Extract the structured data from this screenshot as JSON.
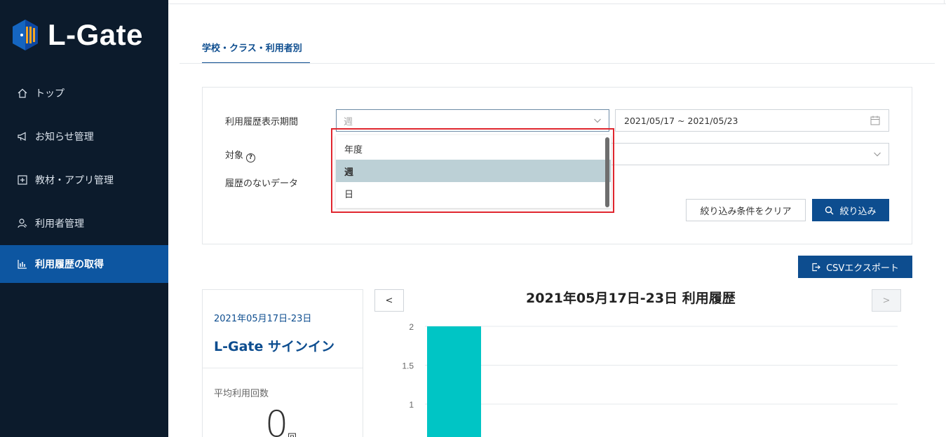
{
  "brand": {
    "name": "L-Gate"
  },
  "sidebar": {
    "items": [
      {
        "label": "トップ",
        "icon": "home-icon"
      },
      {
        "label": "お知らせ管理",
        "icon": "megaphone-icon"
      },
      {
        "label": "教材・アプリ管理",
        "icon": "plus-box-icon"
      },
      {
        "label": "利用者管理",
        "icon": "user-icon"
      },
      {
        "label": "利用履歴の取得",
        "icon": "bar-chart-icon",
        "active": true
      }
    ]
  },
  "tabs": [
    {
      "label": "学校・クラス・利用者別",
      "active": true
    }
  ],
  "filter": {
    "period_label": "利用履歴表示期間",
    "period_value": "週",
    "date_range": "2021/05/17 ~ 2021/05/23",
    "target_label": "対象",
    "target_help": "?",
    "no_history_label": "履歴のないデータ",
    "clear_button": "絞り込み条件をクリア",
    "filter_button": "絞り込み"
  },
  "period_dropdown": {
    "options": [
      "年度",
      "週",
      "日"
    ],
    "selected": "週"
  },
  "export_button": "CSVエクスポート",
  "stats": {
    "date": "2021年05月17日-23日",
    "title": "L-Gate サインイン",
    "avg_label": "平均利用回数",
    "avg_value": "0",
    "avg_unit": "回"
  },
  "chart_nav": {
    "prev": "<",
    "next": ">"
  },
  "chart_data": {
    "type": "bar",
    "title": "2021年05月17日-23日 利用履歴",
    "yticks": [
      "2",
      "1.5",
      "1"
    ],
    "ylim": [
      0,
      2
    ],
    "grid": true,
    "bar_color": "#00c5c5",
    "values": [
      2
    ]
  },
  "colors": {
    "sidebar_bg": "#0c1b2c",
    "accent": "#0d4d8f",
    "bar": "#00c5c5",
    "highlight": "#e0262e"
  }
}
